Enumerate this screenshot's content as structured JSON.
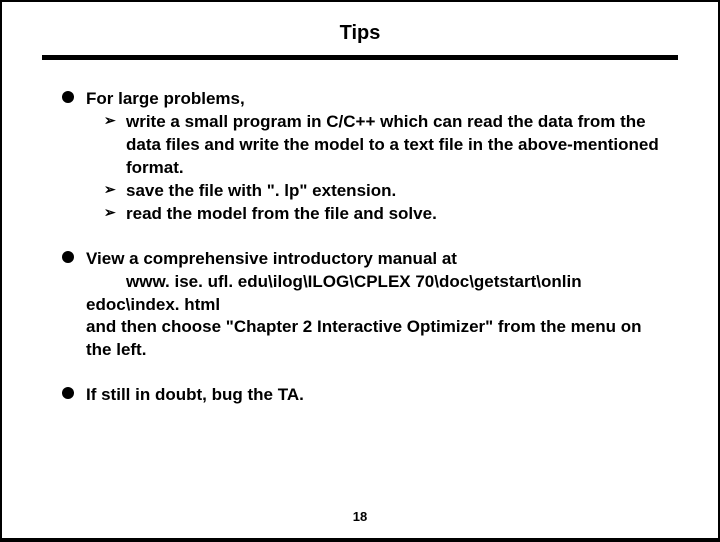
{
  "title": "Tips",
  "page_number": "18",
  "items": [
    {
      "lead": "For large problems,",
      "subs": [
        "write a small program in C/C++ which can read the data from the data files and write the model to a text file in the above-mentioned format.",
        "save the file with \". lp\" extension.",
        "read the model from the file and solve."
      ]
    },
    {
      "line1": "View a comprehensive introductory manual at",
      "indent_line": "www. ise. ufl. edu\\ilog\\ILOG\\CPLEX 70\\doc\\getstart\\onlin",
      "line3": "edoc\\index. html",
      "line4": "and then choose \"Chapter 2 Interactive Optimizer\" from the menu on the left."
    },
    {
      "lead": "If still in doubt, bug the TA."
    }
  ]
}
